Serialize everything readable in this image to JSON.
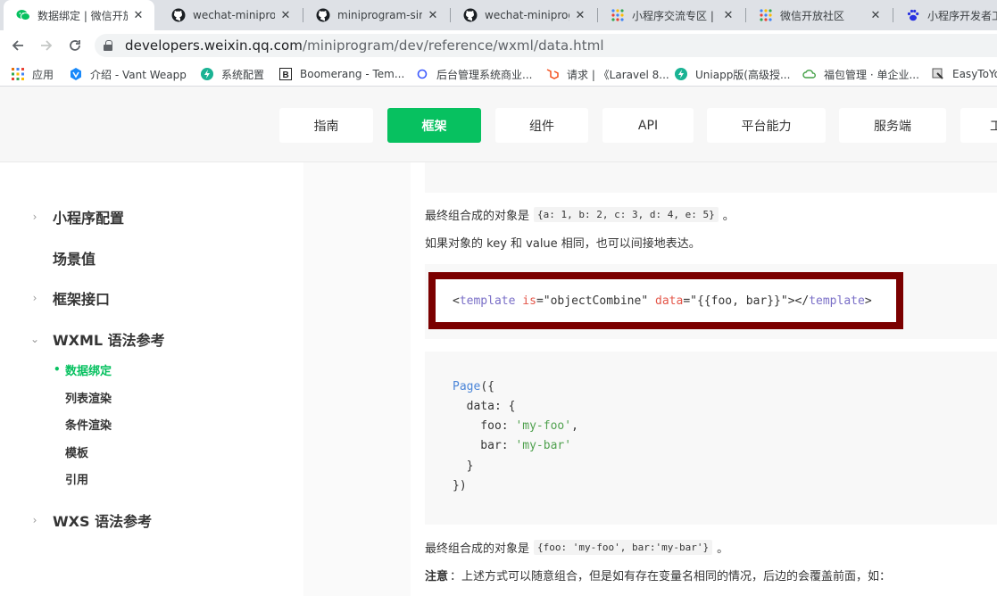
{
  "browser": {
    "tabs": [
      {
        "title": "数据绑定 | 微信开放",
        "icon": "wechat-icon",
        "active": true
      },
      {
        "title": "wechat-miniprog",
        "icon": "github-icon",
        "active": false
      },
      {
        "title": "miniprogram-sim",
        "icon": "github-icon",
        "active": false
      },
      {
        "title": "wechat-miniprog",
        "icon": "github-icon",
        "active": false
      },
      {
        "title": "小程序交流专区 | 微",
        "icon": "grid-icon",
        "active": false
      },
      {
        "title": "微信开放社区",
        "icon": "grid-icon",
        "active": false
      },
      {
        "title": "小程序开发者工",
        "icon": "paw-icon",
        "active": false
      }
    ],
    "url_host": "developers.weixin.qq.com",
    "url_path": "/miniprogram/dev/reference/wxml/data.html",
    "bookmarks": [
      {
        "label": "应用",
        "icon": "apps-grid-icon"
      },
      {
        "label": "介绍 - Vant Weapp",
        "icon": "vant-icon"
      },
      {
        "label": "系统配置",
        "icon": "green-bolt-icon"
      },
      {
        "label": "Boomerang - Tem...",
        "icon": "boomerang-b-icon"
      },
      {
        "label": "后台管理系统商业...",
        "icon": "ring-icon"
      },
      {
        "label": "请求 | 《Laravel 8...",
        "icon": "laravel-icon"
      },
      {
        "label": "Uniapp版(高级授...",
        "icon": "green-bolt-icon"
      },
      {
        "label": "福包管理 · 单企业...",
        "icon": "cloud-icon"
      },
      {
        "label": "EasyToYou",
        "icon": "easytoyou-icon"
      }
    ]
  },
  "site_nav": {
    "items": [
      {
        "label": "指南",
        "active": false
      },
      {
        "label": "框架",
        "active": true
      },
      {
        "label": "组件",
        "active": false
      },
      {
        "label": "API",
        "active": false
      },
      {
        "label": "平台能力",
        "active": false
      },
      {
        "label": "服务端",
        "active": false
      },
      {
        "label": "工",
        "active": false
      }
    ]
  },
  "sidebar": {
    "items": [
      {
        "label": "小程序配置",
        "arrow": "›"
      },
      {
        "label": "场景值",
        "arrow": ""
      },
      {
        "label": "框架接口",
        "arrow": "›"
      },
      {
        "label": "WXML 语法参考",
        "arrow": "⌄"
      },
      {
        "label": "WXS 语法参考",
        "arrow": "›"
      }
    ],
    "subitems": [
      {
        "label": "数据绑定",
        "active": true
      },
      {
        "label": "列表渲染",
        "active": false
      },
      {
        "label": "条件渲染",
        "active": false
      },
      {
        "label": "模板",
        "active": false
      },
      {
        "label": "引用",
        "active": false
      }
    ]
  },
  "content": {
    "p1_text": "最终组合成的对象是",
    "p1_code": "{a: 1, b: 2, c: 3, d: 4, e: 5}",
    "p1_end": "。",
    "p2_text": "如果对象的 key 和 value 相同，也可以间接地表达。",
    "template_code": {
      "lt": "<",
      "tag": "template",
      "attr1": "is",
      "val1": "=\"objectCombine\"",
      "attr2": "data",
      "val2": "=\"{{foo, bar}}\"",
      "close_open": "></",
      "tag_close": "template",
      "gt": ">"
    },
    "page_code": {
      "l1_fn": "Page",
      "l1_rest": "({",
      "l2": "  data: {",
      "l3_key": "    foo: ",
      "l3_val": "'my-foo'",
      "l3_end": ",",
      "l4_key": "    bar: ",
      "l4_val": "'my-bar'",
      "l5": "  }",
      "l6": "})"
    },
    "p3_text": "最终组合成的对象是",
    "p3_code": "{foo: 'my-foo', bar:'my-bar'}",
    "p3_end": "。",
    "p4_bold": "注意",
    "p4_text": "：上述方式可以随意组合，但是如有存在变量名相同的情况，后边的会覆盖前面，如："
  },
  "colors": {
    "accent_green": "#07c160",
    "highlight_border": "#7b0000"
  }
}
